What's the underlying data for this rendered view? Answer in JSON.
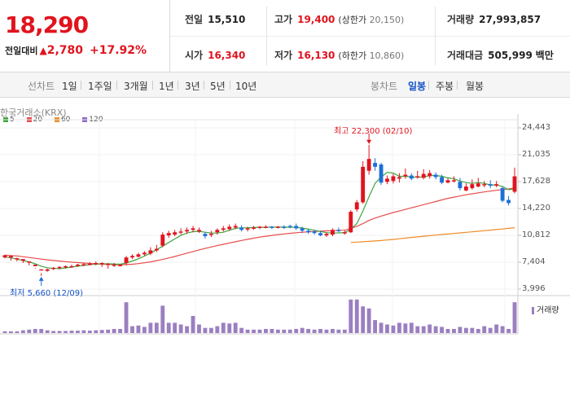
{
  "header": {
    "price": "18,290",
    "change_label": "전일대비",
    "change_arrow": "▲",
    "change_amount": "2,780",
    "change_percent": "+17.92%"
  },
  "stats": {
    "prev_close": {
      "label": "전일",
      "value": "15,510"
    },
    "open": {
      "label": "시가",
      "value": "16,340"
    },
    "high": {
      "label": "고가",
      "value": "19,400",
      "sub_label": "(상한가",
      "sub_value": "20,150)"
    },
    "low": {
      "label": "저가",
      "value": "16,130",
      "sub_label": "(하한가",
      "sub_value": "10,860)"
    },
    "volume": {
      "label": "거래량",
      "value": "27,993,857"
    },
    "amount": {
      "label": "거래대금",
      "value": "505,999",
      "unit": "백만"
    }
  },
  "tabs": {
    "line_chart": "선차트",
    "periods": [
      "1일",
      "1주일",
      "3개월",
      "1년",
      "3년",
      "5년",
      "10년"
    ],
    "candle_chart": "봉차트",
    "candles": [
      "일봉",
      "주봉",
      "월봉"
    ],
    "active_candle": "일봉"
  },
  "chart": {
    "source_label": "한국거래소(KRX)",
    "legend": [
      {
        "name": "5",
        "color": "#3ea63e"
      },
      {
        "name": "20",
        "color": "#e84c4c"
      },
      {
        "name": "60",
        "color": "#f08c28"
      },
      {
        "name": "120",
        "color": "#8b6cc4"
      }
    ],
    "high_annotation": "최고 22,300 (02/10)",
    "low_annotation": "최저 5,660 (12/09)",
    "volume_label": "거래량",
    "colors": {
      "up": "#e0141e",
      "down": "#1e6fd9",
      "ma5": "#3ea63e",
      "ma20": "#e84c4c",
      "ma60": "#f08c28",
      "volume": "#9b7fc0"
    }
  },
  "chart_data": {
    "type": "candlestick",
    "y_ticks": [
      "24,443",
      "21,035",
      "17,628",
      "14,220",
      "10,812",
      "7,404",
      "3,996"
    ],
    "ylim": [
      3996,
      24443
    ],
    "candles": [
      [
        8000,
        8300,
        8200,
        7900,
        0.05
      ],
      [
        8000,
        8200,
        8100,
        7600,
        0.05
      ],
      [
        7800,
        7900,
        8000,
        7500,
        0.05
      ],
      [
        7600,
        7800,
        7700,
        7300,
        0.08
      ],
      [
        7400,
        7500,
        7500,
        7000,
        0.1
      ],
      [
        6900,
        7100,
        6700,
        6600,
        0.12
      ],
      [
        6400,
        6500,
        6000,
        5660,
        0.12
      ],
      [
        6300,
        6500,
        6600,
        6200,
        0.08
      ],
      [
        6600,
        6700,
        6800,
        6400,
        0.06
      ],
      [
        6700,
        6800,
        6900,
        6500,
        0.06
      ],
      [
        6800,
        6900,
        7000,
        6600,
        0.06
      ],
      [
        6900,
        6900,
        7100,
        6700,
        0.07
      ],
      [
        7000,
        7100,
        7200,
        6800,
        0.07
      ],
      [
        7100,
        7150,
        7300,
        6900,
        0.08
      ],
      [
        7100,
        7200,
        7400,
        7000,
        0.07
      ],
      [
        7200,
        7300,
        7500,
        7000,
        0.08
      ],
      [
        7200,
        7300,
        7400,
        6800,
        0.09
      ],
      [
        7100,
        7200,
        7300,
        6600,
        0.1
      ],
      [
        7000,
        7100,
        7300,
        6800,
        0.12
      ],
      [
        7000,
        7050,
        7200,
        6900,
        0.12
      ],
      [
        7300,
        8000,
        8200,
        7000,
        0.9
      ],
      [
        8000,
        8200,
        8400,
        7800,
        0.2
      ],
      [
        8100,
        8400,
        8600,
        8000,
        0.22
      ],
      [
        8400,
        8600,
        8800,
        8200,
        0.18
      ],
      [
        8500,
        8900,
        9300,
        8300,
        0.3
      ],
      [
        8900,
        9100,
        9600,
        8700,
        0.3
      ],
      [
        9500,
        10900,
        11200,
        9300,
        0.8
      ],
      [
        10800,
        11100,
        11400,
        10500,
        0.3
      ],
      [
        10900,
        11200,
        11500,
        10700,
        0.3
      ],
      [
        11200,
        11300,
        11700,
        10900,
        0.25
      ],
      [
        11300,
        11500,
        11800,
        11000,
        0.2
      ],
      [
        11500,
        11700,
        12000,
        11200,
        0.5
      ],
      [
        11300,
        11500,
        11800,
        11100,
        0.25
      ],
      [
        11000,
        10700,
        11200,
        10400,
        0.15
      ],
      [
        10900,
        11000,
        11400,
        10600,
        0.15
      ],
      [
        11200,
        11500,
        11700,
        10900,
        0.2
      ],
      [
        11500,
        11700,
        12000,
        11300,
        0.3
      ],
      [
        11600,
        11900,
        12200,
        11400,
        0.28
      ],
      [
        11800,
        12000,
        12300,
        11600,
        0.3
      ],
      [
        11800,
        11500,
        12100,
        11300,
        0.15
      ],
      [
        11600,
        11700,
        11900,
        11300,
        0.1
      ],
      [
        11700,
        11800,
        12000,
        11500,
        0.1
      ],
      [
        11800,
        11900,
        12000,
        11600,
        0.1
      ],
      [
        11800,
        11900,
        12100,
        11700,
        0.12
      ],
      [
        11900,
        11800,
        12000,
        11600,
        0.12
      ],
      [
        11900,
        11900,
        12000,
        11700,
        0.1
      ],
      [
        11900,
        11850,
        12100,
        11600,
        0.1
      ],
      [
        12000,
        11950,
        12150,
        11700,
        0.1
      ],
      [
        12000,
        11700,
        12300,
        11500,
        0.12
      ],
      [
        11700,
        11400,
        11900,
        11100,
        0.15
      ],
      [
        11400,
        11200,
        11600,
        11000,
        0.12
      ],
      [
        11300,
        11100,
        11500,
        10900,
        0.1
      ],
      [
        11100,
        10800,
        11400,
        10700,
        0.12
      ],
      [
        10800,
        11000,
        11200,
        10600,
        0.1
      ],
      [
        10900,
        11500,
        11700,
        10700,
        0.12
      ],
      [
        11500,
        11400,
        11800,
        11200,
        0.1
      ],
      [
        11100,
        11200,
        11400,
        10900,
        0.1
      ],
      [
        11200,
        13800,
        14000,
        11100,
        0.98
      ],
      [
        14100,
        15000,
        15300,
        13800,
        0.98
      ],
      [
        15000,
        19500,
        20200,
        14800,
        0.78
      ],
      [
        19000,
        20500,
        22300,
        18500,
        0.72
      ],
      [
        20000,
        19500,
        20600,
        19000,
        0.38
      ],
      [
        19800,
        17500,
        20000,
        17200,
        0.3
      ],
      [
        17600,
        18000,
        18400,
        17300,
        0.25
      ],
      [
        17700,
        18300,
        18600,
        17400,
        0.22
      ],
      [
        18000,
        18200,
        18700,
        17500,
        0.3
      ],
      [
        18300,
        18500,
        19300,
        18000,
        0.28
      ],
      [
        18400,
        18000,
        18700,
        17800,
        0.3
      ],
      [
        18200,
        18300,
        19000,
        18000,
        0.2
      ],
      [
        18100,
        18600,
        19200,
        17900,
        0.2
      ],
      [
        18300,
        18700,
        19100,
        18000,
        0.25
      ],
      [
        18500,
        18200,
        18800,
        17900,
        0.2
      ],
      [
        18200,
        17500,
        18500,
        17300,
        0.18
      ],
      [
        17500,
        17800,
        18100,
        17400,
        0.12
      ],
      [
        17700,
        17800,
        18300,
        17500,
        0.12
      ],
      [
        17600,
        16800,
        18100,
        16500,
        0.18
      ],
      [
        16500,
        17000,
        17400,
        16400,
        0.15
      ],
      [
        16800,
        17300,
        17900,
        16600,
        0.15
      ],
      [
        17000,
        17400,
        18100,
        16900,
        0.12
      ],
      [
        17200,
        17300,
        17700,
        16900,
        0.2
      ],
      [
        17300,
        17100,
        17800,
        16800,
        0.15
      ],
      [
        17100,
        17300,
        17700,
        16900,
        0.25
      ],
      [
        16800,
        15200,
        17000,
        15000,
        0.2
      ],
      [
        15300,
        14900,
        15800,
        14600,
        0.12
      ],
      [
        16340,
        18290,
        19400,
        16130,
        0.9
      ]
    ],
    "ma5": [
      8100,
      7950,
      7800,
      7600,
      7450,
      7200,
      6900,
      6700,
      6600,
      6600,
      6680,
      6780,
      6900,
      7000,
      7100,
      7160,
      7200,
      7200,
      7180,
      7150,
      7300,
      7560,
      7840,
      8180,
      8560,
      8980,
      9440,
      9900,
      10360,
      10800,
      11100,
      11280,
      11320,
      11200,
      11100,
      11100,
      11200,
      11450,
      11700,
      11760,
      11770,
      11800,
      11830,
      11840,
      11860,
      11860,
      11850,
      11840,
      11820,
      11740,
      11600,
      11450,
      11300,
      11150,
      11100,
      11120,
      11160,
      11600,
      12300,
      13900,
      15700,
      17400,
      18200,
      18800,
      18700,
      18300,
      18300,
      18200,
      18200,
      18200,
      18400,
      18400,
      18300,
      18100,
      18000,
      17700,
      17500,
      17400,
      17500,
      17400,
      17200,
      17200,
      17000,
      16600,
      16700
    ],
    "ma20": [
      8300,
      8250,
      8200,
      8100,
      8000,
      7900,
      7800,
      7700,
      7620,
      7550,
      7480,
      7400,
      7350,
      7300,
      7250,
      7200,
      7150,
      7120,
      7100,
      7080,
      7100,
      7150,
      7230,
      7330,
      7450,
      7600,
      7760,
      7940,
      8130,
      8340,
      8550,
      8760,
      8960,
      9150,
      9340,
      9510,
      9680,
      9840,
      10000,
      10160,
      10310,
      10450,
      10580,
      10700,
      10800,
      10900,
      10990,
      11070,
      11140,
      11200,
      11250,
      11300,
      11340,
      11380,
      11410,
      11440,
      11460,
      11700,
      11950,
      12300,
      12700,
      13000,
      13250,
      13480,
      13700,
      13900,
      14100,
      14300,
      14500,
      14700,
      14900,
      15100,
      15300,
      15500,
      15650,
      15800,
      15950,
      16080,
      16200,
      16320,
      16420,
      16520,
      16620,
      16700,
      16800
    ],
    "ma60_start_index": 57,
    "ma60": [
      9900,
      9950,
      10000,
      10050,
      10100,
      10150,
      10220,
      10300,
      10380,
      10460,
      10540,
      10620,
      10700,
      10770,
      10840,
      10910,
      10980,
      11050,
      11120,
      11190,
      11260,
      11330,
      11400,
      11470,
      11540,
      11620,
      11700,
      11780
    ]
  }
}
